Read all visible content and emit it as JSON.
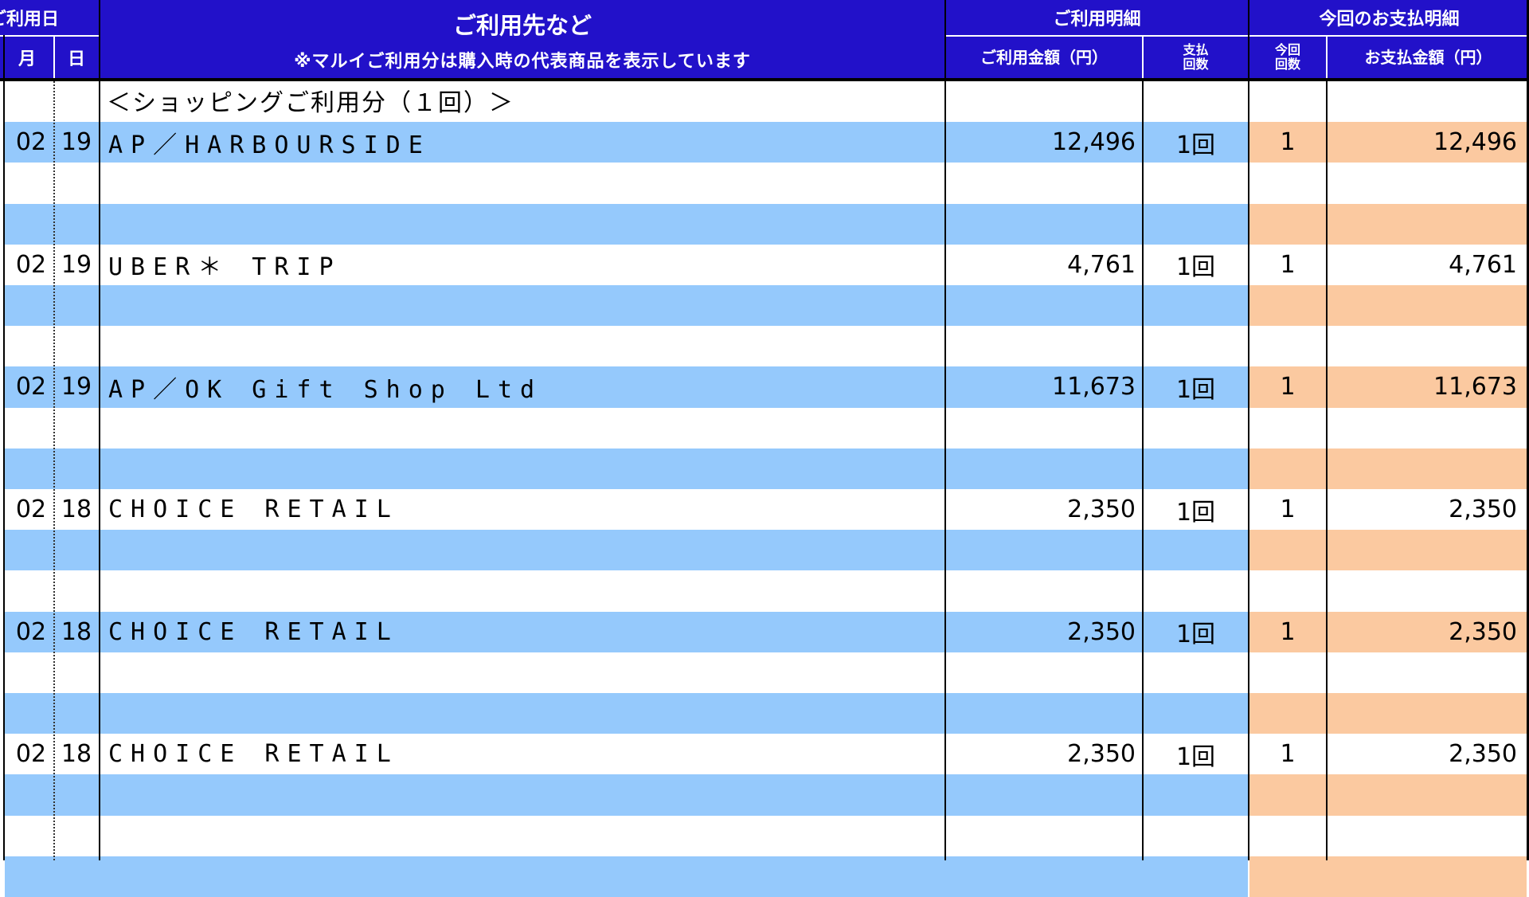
{
  "header": {
    "date_group": "ご利用日",
    "month": "月",
    "day": "日",
    "merchant_title": "ご利用先など",
    "merchant_note": "※マルイご利用分は購入時の代表商品を表示しています",
    "usage_group": "ご利用明細",
    "usage_amount": "ご利用金額（円）",
    "installments_line1": "支払",
    "installments_line2": "回数",
    "payment_group": "今回のお支払明細",
    "this_count_line1": "今回",
    "this_count_line2": "回数",
    "payment_amount": "お支払金額（円）"
  },
  "section_label": "＜ショッピングご利用分（１回）＞",
  "transactions": [
    {
      "month": "02",
      "day": "19",
      "merchant": "AP／HARBOURSIDE",
      "amount": "12,496",
      "installments": "1回",
      "count": "1",
      "payment": "12,496"
    },
    {
      "month": "02",
      "day": "19",
      "merchant": "UBER＊ TRIP",
      "amount": "4,761",
      "installments": "1回",
      "count": "1",
      "payment": "4,761"
    },
    {
      "month": "02",
      "day": "19",
      "merchant": "AP／OK Gift Shop Ltd",
      "amount": "11,673",
      "installments": "1回",
      "count": "1",
      "payment": "11,673"
    },
    {
      "month": "02",
      "day": "18",
      "merchant": "CHOICE RETAIL",
      "amount": "2,350",
      "installments": "1回",
      "count": "1",
      "payment": "2,350"
    },
    {
      "month": "02",
      "day": "18",
      "merchant": "CHOICE RETAIL",
      "amount": "2,350",
      "installments": "1回",
      "count": "1",
      "payment": "2,350"
    },
    {
      "month": "02",
      "day": "18",
      "merchant": "CHOICE RETAIL",
      "amount": "2,350",
      "installments": "1回",
      "count": "1",
      "payment": "2,350"
    }
  ],
  "colors": {
    "header_bg": "#2211c9",
    "blue_band": "#95c9fc",
    "orange_band": "#fbc9a0"
  }
}
